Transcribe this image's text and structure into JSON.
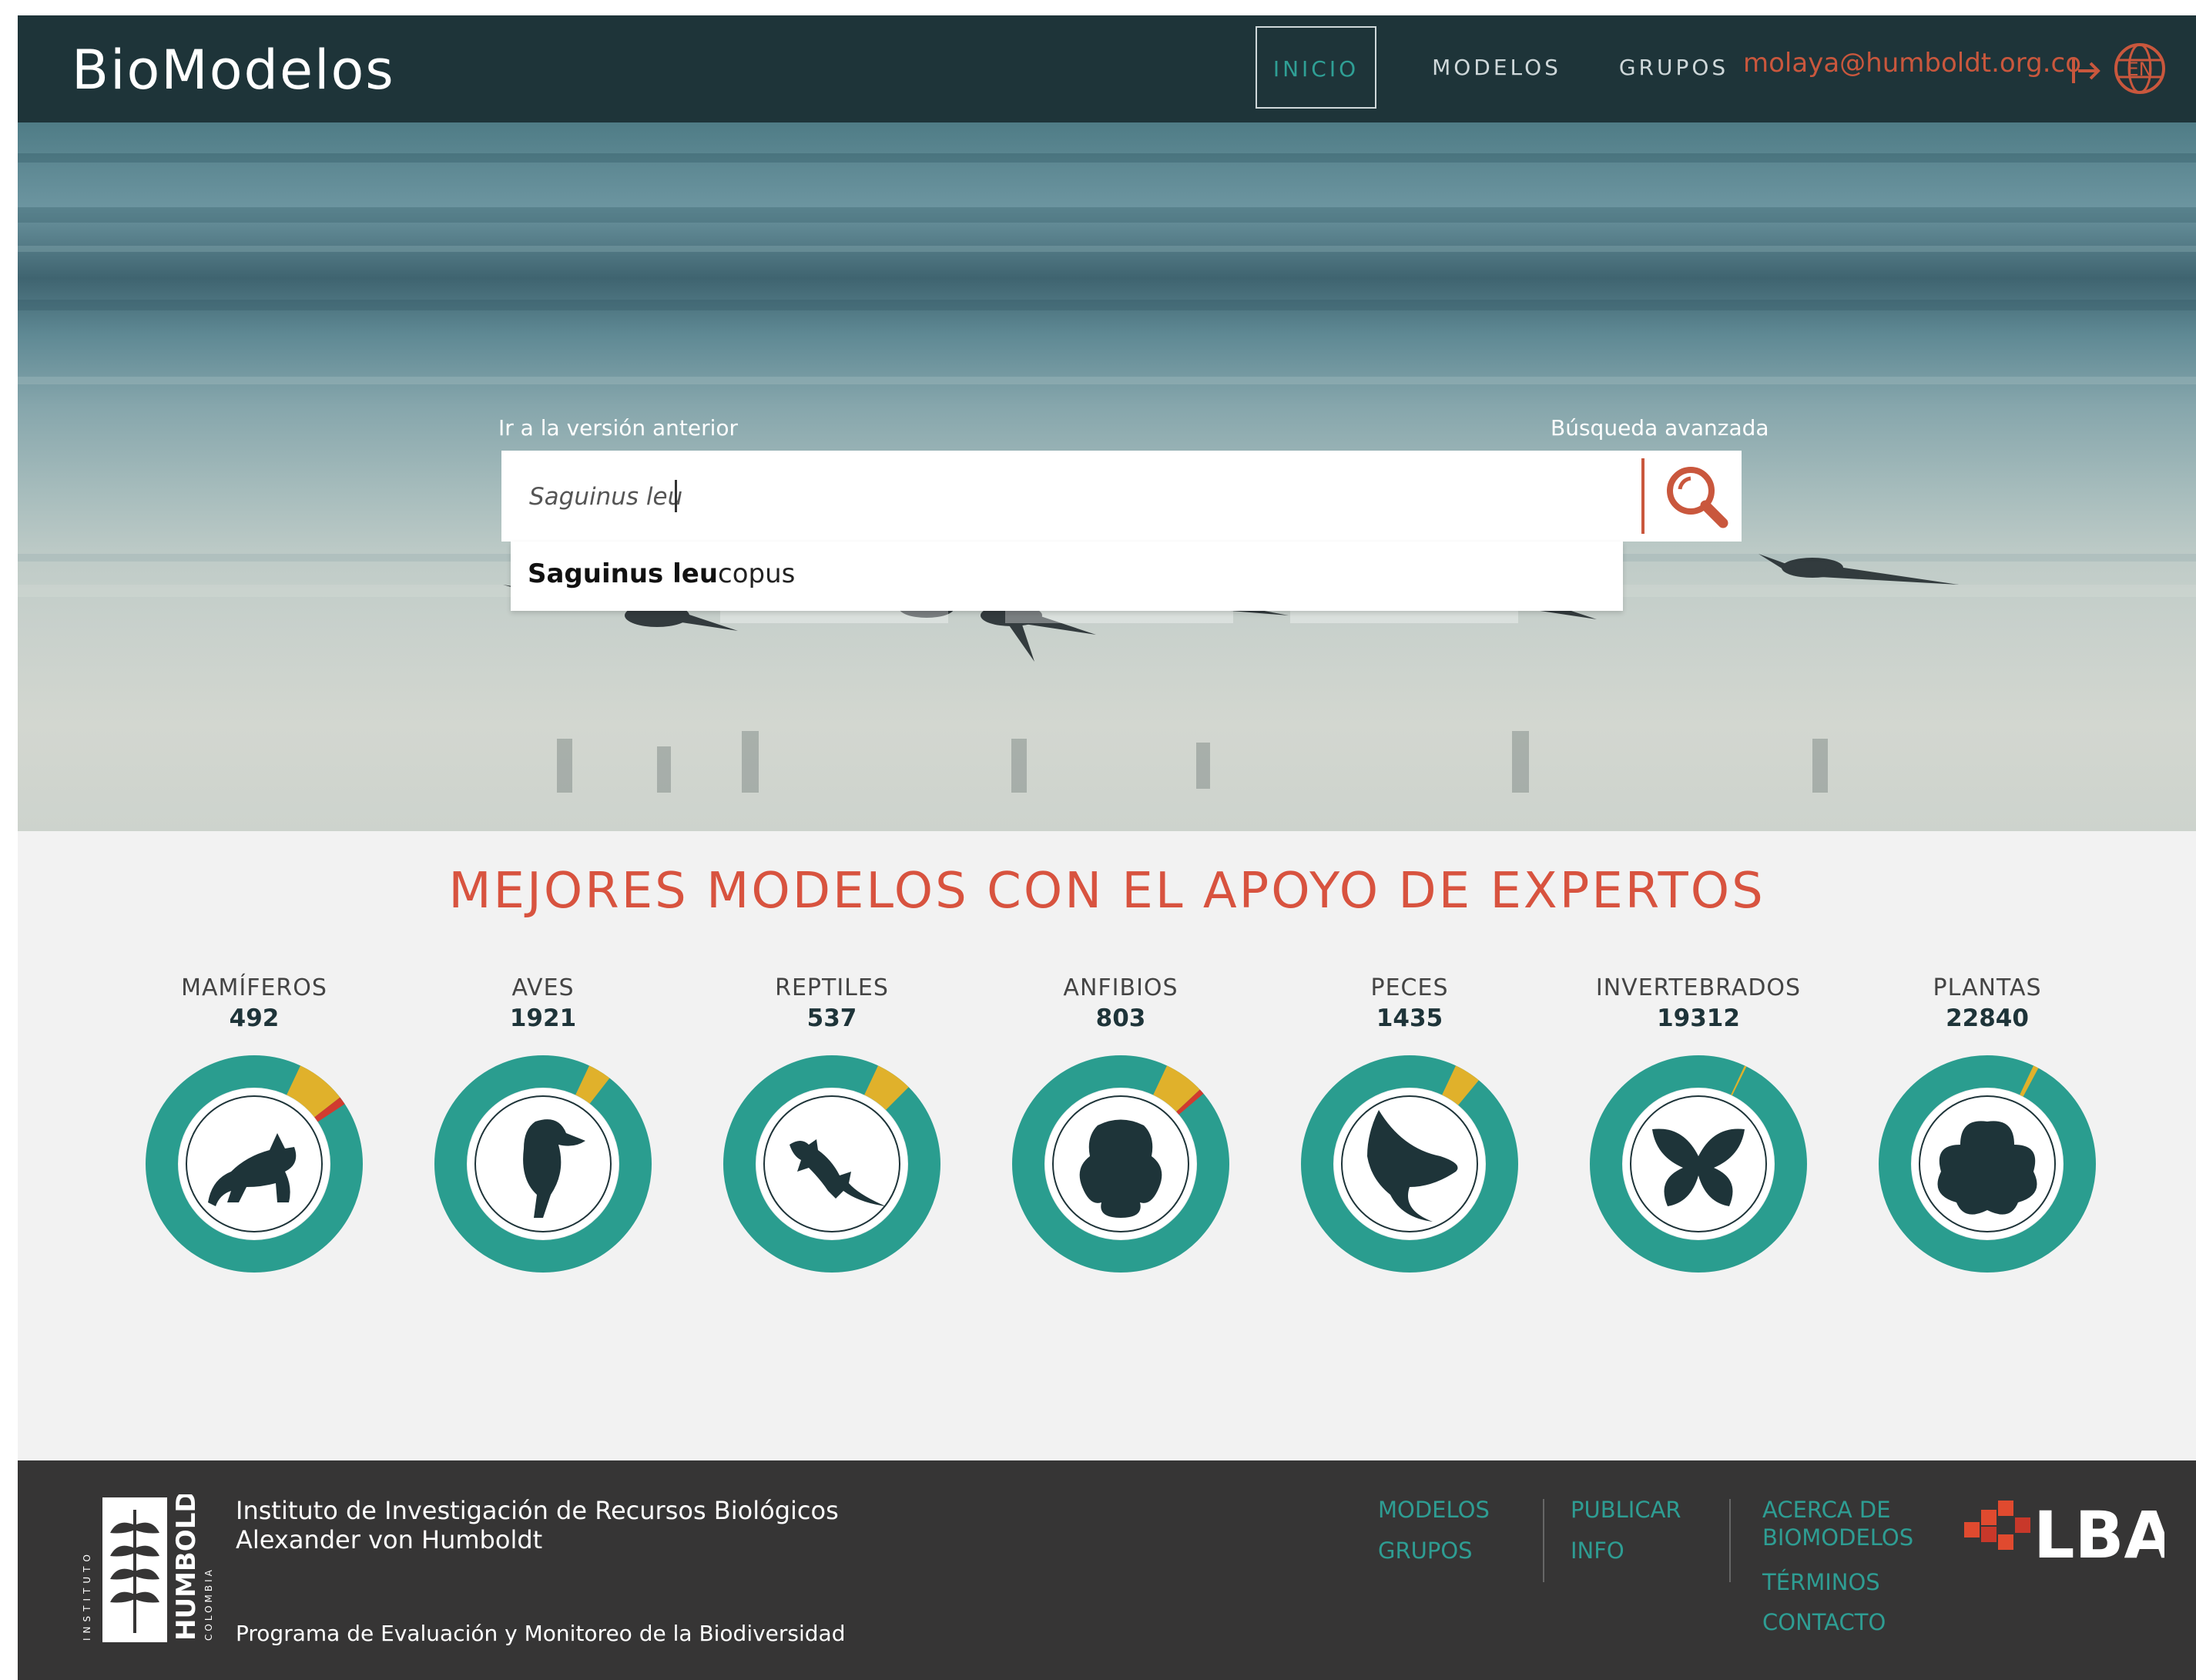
{
  "app": {
    "brand": "BioModelos"
  },
  "nav": {
    "items": [
      "INICIO",
      "MODELOS",
      "GRUPOS"
    ],
    "active": "INICIO",
    "user_email": "molaya@humboldt.org.co",
    "language_label": "EN"
  },
  "search": {
    "prev_version_link": "Ir a la versión anterior",
    "advanced_link": "Búsqueda avanzada",
    "query": "Saguinus leu",
    "suggestion_match": "Saguinus leu",
    "suggestion_rest": "copus"
  },
  "headline": "MEJORES MODELOS CON EL APOYO DE EXPERTOS",
  "groups": [
    {
      "name": "MAMÍFEROS",
      "count": "492",
      "icon": "mammal-icon"
    },
    {
      "name": "AVES",
      "count": "1921",
      "icon": "bird-icon"
    },
    {
      "name": "REPTILES",
      "count": "537",
      "icon": "lizard-icon"
    },
    {
      "name": "ANFIBIOS",
      "count": "803",
      "icon": "frog-icon"
    },
    {
      "name": "PECES",
      "count": "1435",
      "icon": "fish-icon"
    },
    {
      "name": "INVERTEBRADOS",
      "count": "19312",
      "icon": "butterfly-icon"
    },
    {
      "name": "PLANTAS",
      "count": "22840",
      "icon": "flower-icon"
    }
  ],
  "donut_segments": [
    {
      "approved": 0.075,
      "pending": 0.012
    },
    {
      "approved": 0.035,
      "pending": 0.0
    },
    {
      "approved": 0.055,
      "pending": 0.0
    },
    {
      "approved": 0.06,
      "pending": 0.008
    },
    {
      "approved": 0.04,
      "pending": 0.0
    },
    {
      "approved": 0.003,
      "pending": 0.0
    },
    {
      "approved": 0.008,
      "pending": 0.0
    }
  ],
  "colors": {
    "topbar": "#1e3439",
    "teal": "#2a9d8f",
    "accent_red": "#d8533f",
    "approved_yellow": "#e0b12b",
    "pending_red": "#d13b2f",
    "footer": "#363535"
  },
  "footer": {
    "institute_line1": "Instituto de Investigación de Recursos Biológicos",
    "institute_line2": "Alexander von Humboldt",
    "logo_text": "HUMBOLDT",
    "logo_small": "INSTITUTO",
    "logo_country": "COLOMBIA",
    "program": "Programa de Evaluación y Monitoreo de la Biodiversidad",
    "col1": [
      "MODELOS",
      "GRUPOS"
    ],
    "col2": [
      "PUBLICAR",
      "INFO"
    ],
    "col3": [
      "ACERCA DE",
      "BIOMODELOS",
      "TÉRMINOS",
      "CONTACTO"
    ],
    "partner_logo": "LBA"
  }
}
